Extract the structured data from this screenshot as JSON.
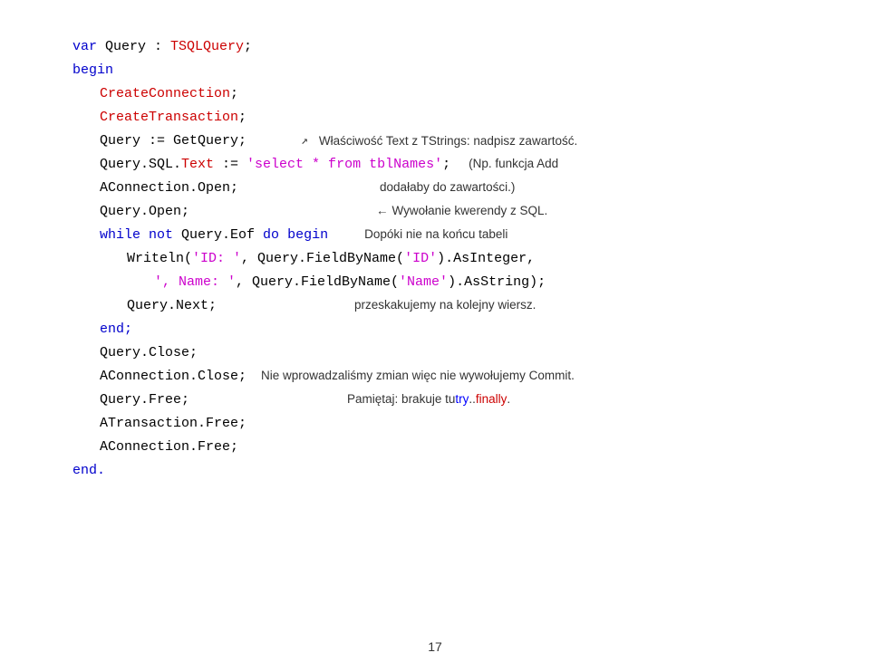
{
  "page": {
    "number": "17",
    "background": "#ffffff"
  },
  "code": {
    "lines": [
      {
        "id": "line1",
        "indent": 0,
        "parts": [
          {
            "text": "var ",
            "style": "kw-blue"
          },
          {
            "text": "Query",
            "style": "text-black"
          },
          {
            "text": " : ",
            "style": "text-black"
          },
          {
            "text": "TSQLQuery",
            "style": "kw-red"
          },
          {
            "text": ";",
            "style": "text-black"
          }
        ],
        "annotation": null
      },
      {
        "id": "line2",
        "indent": 0,
        "parts": [
          {
            "text": "begin",
            "style": "kw-blue"
          }
        ],
        "annotation": null
      },
      {
        "id": "line3",
        "indent": 1,
        "parts": [
          {
            "text": "CreateConnection",
            "style": "kw-red"
          },
          {
            "text": ";",
            "style": "text-black"
          }
        ],
        "annotation": null
      },
      {
        "id": "line4",
        "indent": 1,
        "parts": [
          {
            "text": "CreateTransaction",
            "style": "kw-red"
          },
          {
            "text": ";",
            "style": "text-black"
          }
        ],
        "annotation": null
      },
      {
        "id": "line5",
        "indent": 1,
        "parts": [
          {
            "text": "Query := GetQuery;",
            "style": "text-black"
          }
        ],
        "annotation": {
          "type": "diag-arrow",
          "text": "Właściwość Text z TStrings: nadpisz zawartość."
        }
      },
      {
        "id": "line6",
        "indent": 1,
        "parts": [
          {
            "text": "Query.SQL.",
            "style": "text-black"
          },
          {
            "text": "Text",
            "style": "kw-red"
          },
          {
            "text": " := ",
            "style": "text-black"
          },
          {
            "text": "'select * from tblNames'",
            "style": "kw-magenta"
          },
          {
            "text": ";",
            "style": "text-black"
          }
        ],
        "annotation": {
          "type": "plain",
          "text": "(Np. funkcja Add"
        }
      },
      {
        "id": "line7",
        "indent": 1,
        "parts": [
          {
            "text": "AConnection.Open;",
            "style": "text-black"
          }
        ],
        "annotation": {
          "type": "plain",
          "text": "dodałaby do zawartości.)"
        }
      },
      {
        "id": "line8",
        "indent": 1,
        "parts": [
          {
            "text": "Query.Open;",
            "style": "text-black"
          }
        ],
        "annotation": {
          "type": "left-arrow",
          "text": "Wywołanie kwerendy z SQL."
        }
      },
      {
        "id": "line9",
        "indent": 1,
        "parts": [
          {
            "text": "while ",
            "style": "kw-blue"
          },
          {
            "text": "not ",
            "style": "kw-blue"
          },
          {
            "text": "Query.Eof ",
            "style": "text-black"
          },
          {
            "text": "do ",
            "style": "kw-blue"
          },
          {
            "text": "begin",
            "style": "kw-blue"
          }
        ],
        "annotation": {
          "type": "plain",
          "text": "Dopóki nie na końcu tabeli"
        }
      },
      {
        "id": "line10",
        "indent": 2,
        "parts": [
          {
            "text": "Writeln(",
            "style": "text-black"
          },
          {
            "text": "'ID: '",
            "style": "kw-magenta"
          },
          {
            "text": ", Query.FieldByName(",
            "style": "text-black"
          },
          {
            "text": "'ID'",
            "style": "kw-magenta"
          },
          {
            "text": ").AsInteger,",
            "style": "text-black"
          }
        ],
        "annotation": null
      },
      {
        "id": "line11",
        "indent": 3,
        "parts": [
          {
            "text": "', Name: '",
            "style": "kw-magenta"
          },
          {
            "text": ", Query.FieldByName(",
            "style": "text-black"
          },
          {
            "text": "'Name'",
            "style": "kw-magenta"
          },
          {
            "text": ").AsString);",
            "style": "text-black"
          }
        ],
        "annotation": null
      },
      {
        "id": "line12",
        "indent": 2,
        "parts": [
          {
            "text": "Query.Next;",
            "style": "text-black"
          }
        ],
        "annotation": {
          "type": "plain",
          "text": "przeskakujemy na kolejny wiersz."
        }
      },
      {
        "id": "line13",
        "indent": 1,
        "parts": [
          {
            "text": "end;",
            "style": "kw-blue"
          }
        ],
        "annotation": null
      },
      {
        "id": "line14",
        "indent": 1,
        "parts": [
          {
            "text": "Query.Close;",
            "style": "text-black"
          }
        ],
        "annotation": null
      },
      {
        "id": "line15",
        "indent": 1,
        "parts": [
          {
            "text": "AConnection.Close;",
            "style": "text-black"
          }
        ],
        "annotation": {
          "type": "plain",
          "text": "Nie wprowadzaliśmy zmian więc nie wywołujemy Commit."
        }
      },
      {
        "id": "line16",
        "indent": 1,
        "parts": [
          {
            "text": "Query.Free;",
            "style": "text-black"
          }
        ],
        "annotation": {
          "type": "try-finally",
          "prefix": "Pamiętaj: brakuje tu ",
          "try": "try",
          "separator": "..",
          "finally": "finally",
          "suffix": "."
        }
      },
      {
        "id": "line17",
        "indent": 1,
        "parts": [
          {
            "text": "ATransaction.Free;",
            "style": "text-black"
          }
        ],
        "annotation": null
      },
      {
        "id": "line18",
        "indent": 1,
        "parts": [
          {
            "text": "AConnection.Free;",
            "style": "text-black"
          }
        ],
        "annotation": null
      },
      {
        "id": "line19",
        "indent": 0,
        "parts": [
          {
            "text": "end.",
            "style": "kw-blue"
          }
        ],
        "annotation": null
      }
    ]
  },
  "annotations": {
    "line5": "Właściwość Text z TStrings: nadpisz zawartość.",
    "line6_part1": "(Np. funkcja Add",
    "line7_part1": "dodałaby do zawartości.)",
    "line8_arrow": "Wywołanie kwerendy z SQL.",
    "line9_part1": "Dopóki nie na końcu tabeli",
    "line12_part1": "przeskakujemy na kolejny wiersz.",
    "line15_part1": "Nie wprowadzaliśmy zmian więc nie wywołujemy Commit.",
    "line16_prefix": "Pamiętaj: brakuje tu ",
    "line16_try": "try",
    "line16_sep": "..",
    "line16_finally": "finally",
    "line16_suffix": "."
  }
}
